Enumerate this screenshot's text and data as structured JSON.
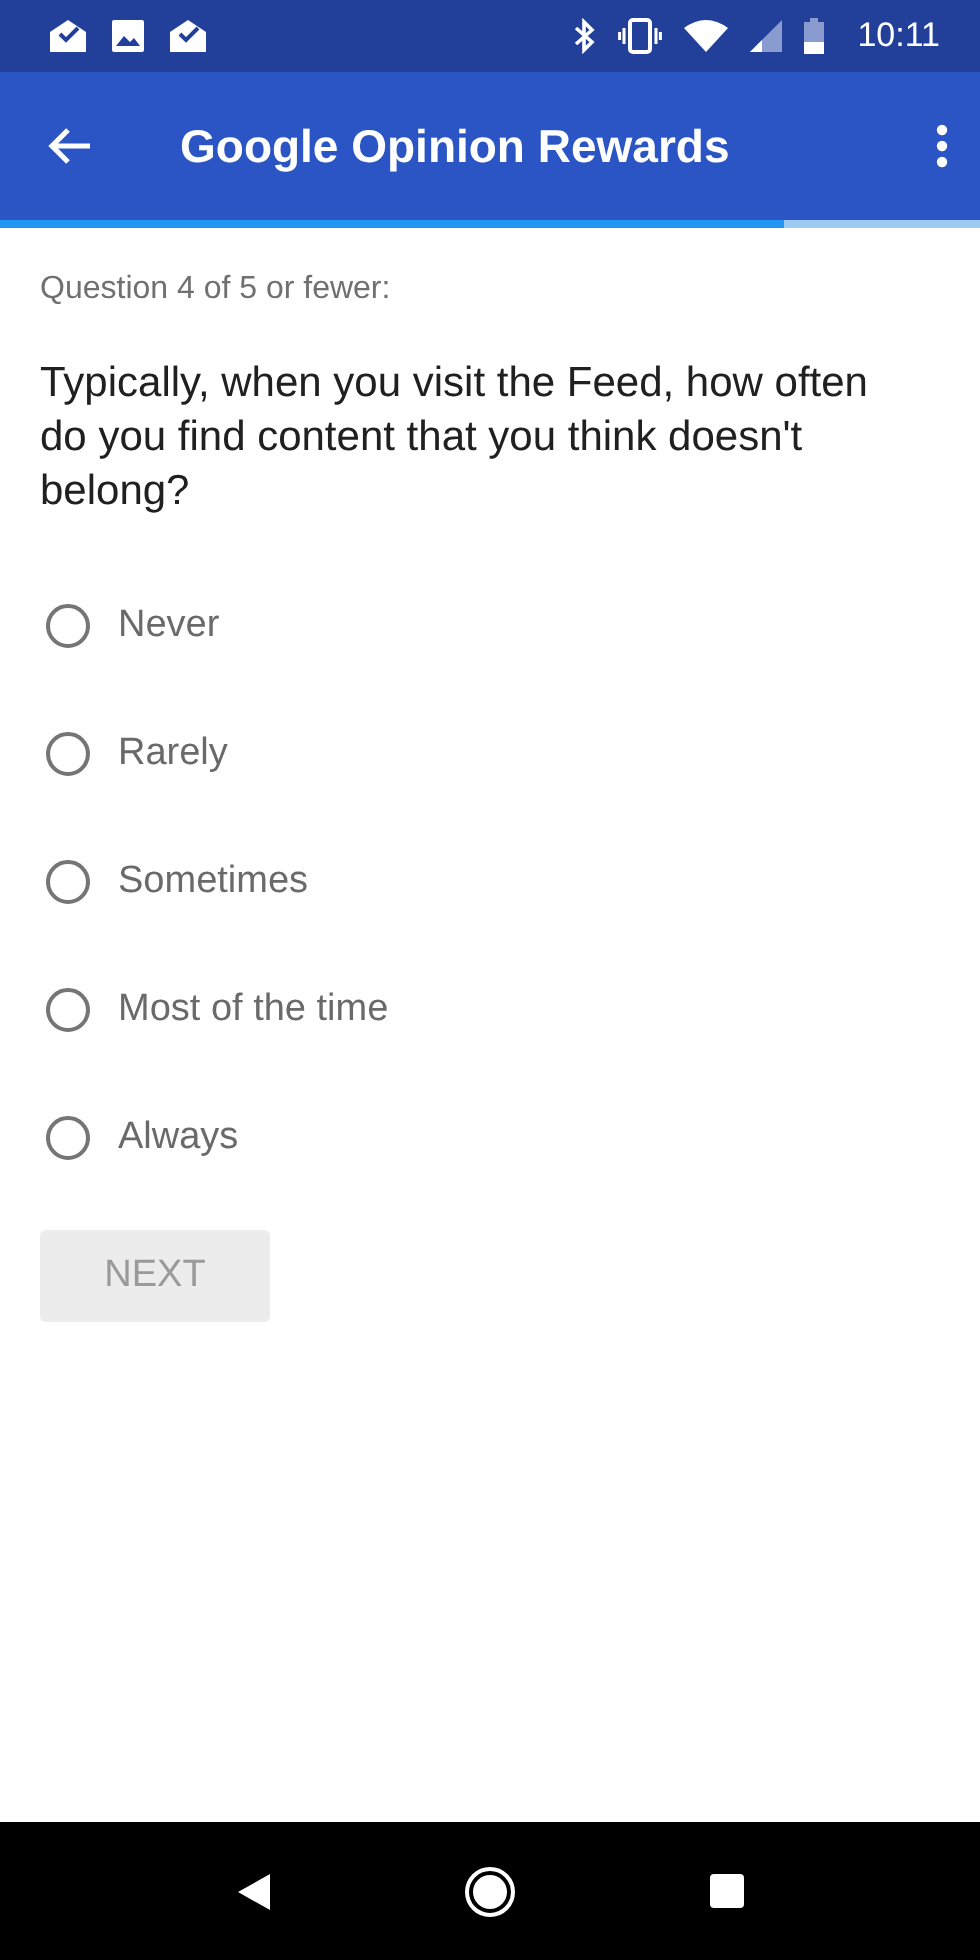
{
  "status_bar": {
    "time": "10:11"
  },
  "app_bar": {
    "title": "Google Opinion Rewards"
  },
  "progress": {
    "level": 0.8
  },
  "question_counter": "Question 4 of 5 or fewer:",
  "question": "Typically, when you visit the Feed, how often do you find content that you think doesn't belong?",
  "options": [
    {
      "label": "Never",
      "selected": false
    },
    {
      "label": "Rarely",
      "selected": false
    },
    {
      "label": "Sometimes",
      "selected": false
    },
    {
      "label": "Most of the time",
      "selected": false
    },
    {
      "label": "Always",
      "selected": false
    }
  ],
  "next_button": {
    "label": "NEXT",
    "disabled": true
  }
}
